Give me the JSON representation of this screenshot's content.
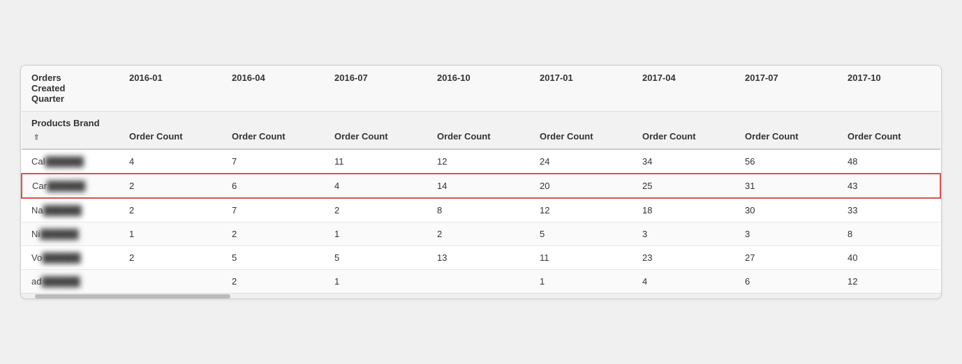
{
  "table": {
    "header_row1": {
      "col0": "Orders\nCreated\nQuarter",
      "col1": "2016-01",
      "col2": "2016-04",
      "col3": "2016-07",
      "col4": "2016-10",
      "col5": "2017-01",
      "col6": "2017-04",
      "col7": "2017-07",
      "col8": "2017-10"
    },
    "header_row2": {
      "col0": "Products Brand",
      "col1": "Order Count",
      "col2": "Order Count",
      "col3": "Order Count",
      "col4": "Order Count",
      "col5": "Order Count",
      "col6": "Order Count",
      "col7": "Order Count",
      "col8": "Order Count"
    },
    "rows": [
      {
        "brand": "Cal",
        "blur": true,
        "values": [
          "4",
          "7",
          "11",
          "12",
          "24",
          "34",
          "56",
          "48"
        ],
        "highlighted": false
      },
      {
        "brand": "Car",
        "blur": true,
        "values": [
          "2",
          "6",
          "4",
          "14",
          "20",
          "25",
          "31",
          "43"
        ],
        "highlighted": true
      },
      {
        "brand": "Na",
        "blur": true,
        "values": [
          "2",
          "7",
          "2",
          "8",
          "12",
          "18",
          "30",
          "33"
        ],
        "highlighted": false
      },
      {
        "brand": "Ni",
        "blur": true,
        "values": [
          "1",
          "2",
          "1",
          "2",
          "5",
          "3",
          "3",
          "8"
        ],
        "highlighted": false
      },
      {
        "brand": "Vo",
        "blur": true,
        "values": [
          "2",
          "5",
          "5",
          "13",
          "11",
          "23",
          "27",
          "40"
        ],
        "highlighted": false
      },
      {
        "brand": "ad",
        "blur": true,
        "values": [
          "",
          "2",
          "1",
          "",
          "1",
          "4",
          "6",
          "12"
        ],
        "highlighted": false
      }
    ]
  }
}
